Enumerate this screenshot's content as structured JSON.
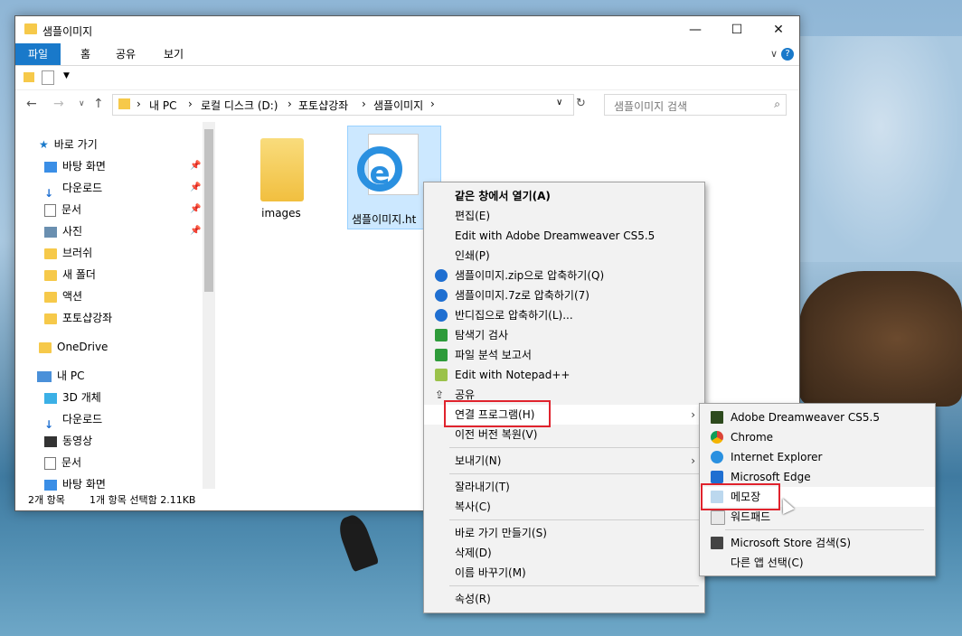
{
  "window": {
    "title": "샘플이미지",
    "minimize": "—",
    "maximize": "☐",
    "close": "✕"
  },
  "ribbon": {
    "tabs": [
      "파일",
      "홈",
      "공유",
      "보기"
    ],
    "expand": "∨",
    "help": "?"
  },
  "address": {
    "crumbs": [
      "내 PC",
      "로컬 디스크 (D:)",
      "포토샵강좌",
      "샘플이미지"
    ],
    "search_placeholder": "샘플이미지 검색"
  },
  "nav": {
    "quick_access": "바로 가기",
    "items": [
      {
        "label": "바탕 화면",
        "pinned": true
      },
      {
        "label": "다운로드",
        "pinned": true
      },
      {
        "label": "문서",
        "pinned": true
      },
      {
        "label": "사진",
        "pinned": true
      },
      {
        "label": "브러쉬",
        "pinned": false
      },
      {
        "label": "새 폴더",
        "pinned": false
      },
      {
        "label": "액션",
        "pinned": false
      },
      {
        "label": "포토샵강좌",
        "pinned": false
      }
    ],
    "onedrive": "OneDrive",
    "this_pc": "내 PC",
    "pc_items": [
      "3D 개체",
      "다운로드",
      "동영상",
      "문서",
      "바탕 화면"
    ]
  },
  "files": [
    {
      "name": "images"
    },
    {
      "name": "샘플이미지.ht"
    }
  ],
  "status": {
    "count": "2개 항목",
    "selection": "1개 항목 선택함 2.11KB"
  },
  "context_menu": {
    "items": [
      "같은 창에서 열기(A)",
      "편집(E)",
      "Edit with Adobe Dreamweaver CS5.5",
      "인쇄(P)",
      "샘플이미지.zip으로 압축하기(Q)",
      "샘플이미지.7z로 압축하기(7)",
      "반디집으로 압축하기(L)...",
      "탐색기 검사",
      "파일 분석 보고서",
      "Edit with Notepad++",
      "공유",
      "연결 프로그램(H)",
      "이전 버전 복원(V)",
      "보내기(N)",
      "잘라내기(T)",
      "복사(C)",
      "바로 가기 만들기(S)",
      "삭제(D)",
      "이름 바꾸기(M)",
      "속성(R)"
    ]
  },
  "open_with_menu": {
    "items": [
      "Adobe Dreamweaver CS5.5",
      "Chrome",
      "Internet Explorer",
      "Microsoft Edge",
      "메모장",
      "워드패드",
      "Microsoft Store 검색(S)",
      "다른 앱 선택(C)"
    ]
  },
  "colors": {
    "accent": "#1979ca",
    "highlight_box": "#e0232d",
    "selection": "#cce8ff"
  }
}
